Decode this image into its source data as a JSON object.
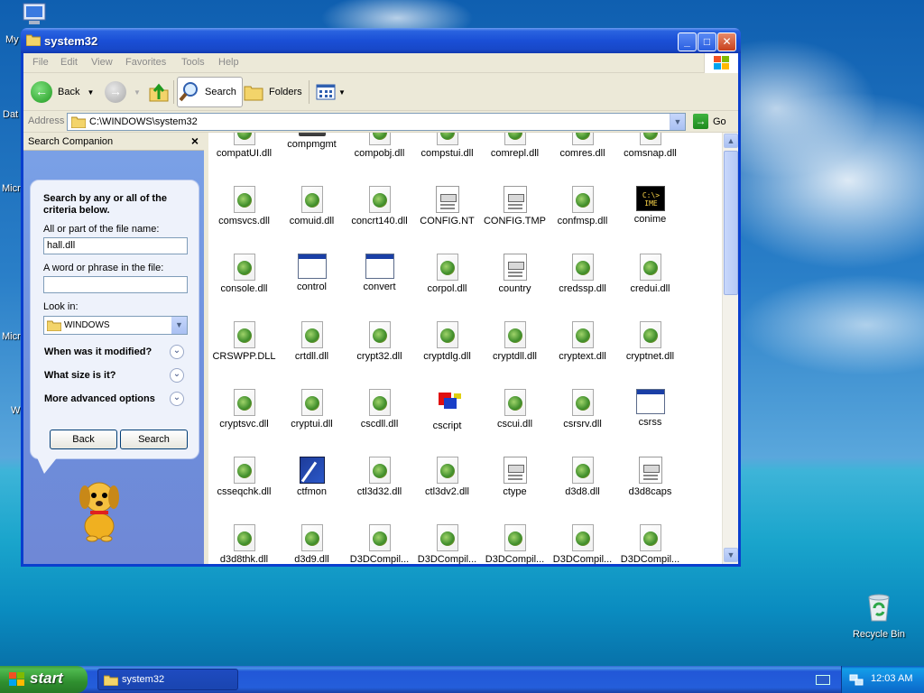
{
  "desktop": {
    "icons": [
      "My",
      "Dat",
      "Micro",
      "Micro",
      "W"
    ],
    "recycle_bin": "Recycle Bin"
  },
  "window": {
    "title": "system32",
    "menu": [
      "File",
      "Edit",
      "View",
      "Favorites",
      "Tools",
      "Help"
    ],
    "toolbar": {
      "back": "Back",
      "search": "Search",
      "folders": "Folders"
    },
    "address": {
      "label": "Address",
      "value": "C:\\WINDOWS\\system32",
      "go": "Go"
    }
  },
  "search_companion": {
    "title": "Search Companion",
    "heading": "Search by any or all of the criteria below.",
    "file_name_label": "All or part of the file name:",
    "file_name_value": "hall.dll",
    "phrase_label": "A word or phrase in the file:",
    "phrase_value": "",
    "look_in_label": "Look in:",
    "look_in_value": "WINDOWS",
    "options": [
      "When was it modified?",
      "What size is it?",
      "More advanced options"
    ],
    "back_button": "Back",
    "search_button": "Search"
  },
  "files": [
    {
      "name": "compatUI.dll",
      "icon": "dll-icon"
    },
    {
      "name": "compmgmt",
      "icon": "drive-icon"
    },
    {
      "name": "compobj.dll",
      "icon": "dll-icon"
    },
    {
      "name": "compstui.dll",
      "icon": "dll-icon"
    },
    {
      "name": "comrepl.dll",
      "icon": "dll-icon"
    },
    {
      "name": "comres.dll",
      "icon": "dll-icon"
    },
    {
      "name": "comsnap.dll",
      "icon": "dll-icon"
    },
    {
      "name": "comsvcs.dll",
      "icon": "dll-icon"
    },
    {
      "name": "comuid.dll",
      "icon": "dll-icon"
    },
    {
      "name": "concrt140.dll",
      "icon": "dll-icon"
    },
    {
      "name": "CONFIG.NT",
      "icon": "config-icon"
    },
    {
      "name": "CONFIG.TMP",
      "icon": "config-icon"
    },
    {
      "name": "confmsp.dll",
      "icon": "dll-icon"
    },
    {
      "name": "conime",
      "icon": "ime-icon"
    },
    {
      "name": "console.dll",
      "icon": "dll-icon"
    },
    {
      "name": "control",
      "icon": "app-icon"
    },
    {
      "name": "convert",
      "icon": "app-icon"
    },
    {
      "name": "corpol.dll",
      "icon": "dll-icon"
    },
    {
      "name": "country",
      "icon": "config-icon"
    },
    {
      "name": "credssp.dll",
      "icon": "dll-icon"
    },
    {
      "name": "credui.dll",
      "icon": "dll-icon"
    },
    {
      "name": "CRSWPP.DLL",
      "icon": "dll-icon"
    },
    {
      "name": "crtdll.dll",
      "icon": "dll-icon"
    },
    {
      "name": "crypt32.dll",
      "icon": "dll-icon"
    },
    {
      "name": "cryptdlg.dll",
      "icon": "dll-icon"
    },
    {
      "name": "cryptdll.dll",
      "icon": "dll-icon"
    },
    {
      "name": "cryptext.dll",
      "icon": "dll-icon"
    },
    {
      "name": "cryptnet.dll",
      "icon": "dll-icon"
    },
    {
      "name": "cryptsvc.dll",
      "icon": "dll-icon"
    },
    {
      "name": "cryptui.dll",
      "icon": "dll-icon"
    },
    {
      "name": "cscdll.dll",
      "icon": "dll-icon"
    },
    {
      "name": "cscript",
      "icon": "script-icon"
    },
    {
      "name": "cscui.dll",
      "icon": "dll-icon"
    },
    {
      "name": "csrsrv.dll",
      "icon": "dll-icon"
    },
    {
      "name": "csrss",
      "icon": "app-icon"
    },
    {
      "name": "csseqchk.dll",
      "icon": "dll-icon"
    },
    {
      "name": "ctfmon",
      "icon": "ctfmon-icon"
    },
    {
      "name": "ctl3d32.dll",
      "icon": "dll-icon"
    },
    {
      "name": "ctl3dv2.dll",
      "icon": "dll-icon"
    },
    {
      "name": "ctype",
      "icon": "config-icon"
    },
    {
      "name": "d3d8.dll",
      "icon": "dll-icon"
    },
    {
      "name": "d3d8caps",
      "icon": "config-icon"
    },
    {
      "name": "d3d8thk.dll",
      "icon": "dll-icon"
    },
    {
      "name": "d3d9.dll",
      "icon": "dll-icon"
    },
    {
      "name": "D3DCompil...",
      "icon": "dll-icon"
    },
    {
      "name": "D3DCompil...",
      "icon": "dll-icon"
    },
    {
      "name": "D3DCompil...",
      "icon": "dll-icon"
    },
    {
      "name": "D3DCompil...",
      "icon": "dll-icon"
    },
    {
      "name": "D3DCompil...",
      "icon": "dll-icon"
    }
  ],
  "taskbar": {
    "start": "start",
    "task": "system32",
    "clock": "12:03 AM"
  },
  "colors": {
    "title_blue": "#1a4fd6",
    "start_green": "#2f8f2f",
    "pane_blue": "#7ba2e7"
  }
}
